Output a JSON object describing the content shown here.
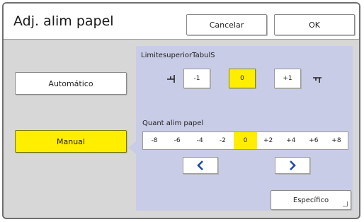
{
  "window": {
    "title": "Adj. alim papel",
    "cancel_label": "Cancelar",
    "ok_label": "OK"
  },
  "mode": {
    "auto_label": "Automático",
    "manual_label": "Manual",
    "selected": "Manual"
  },
  "top_limit": {
    "label": "LimitesuperiorTabulS",
    "options": [
      "-1",
      "0",
      "+1"
    ],
    "selected": "0",
    "left_icon": "edge-left-icon",
    "right_icon": "edge-right-icon"
  },
  "feed": {
    "label": "Quant alim papel",
    "scale": [
      "-8",
      "-6",
      "-4",
      "-2",
      "0",
      "+2",
      "+4",
      "+6",
      "+8"
    ],
    "selected": "0",
    "left_icon": "chevron-left-icon",
    "right_icon": "chevron-right-icon"
  },
  "specific_label": "Específico",
  "colors": {
    "selected": "#ffee00",
    "panel": "#c9cce6",
    "arrow": "#1f4aa8"
  }
}
